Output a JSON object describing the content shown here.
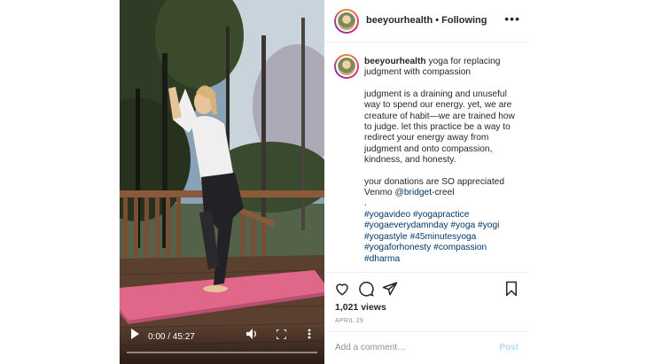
{
  "video": {
    "time": "0:00 / 45:27",
    "progress_fraction": 0.0
  },
  "header": {
    "username": "beeyourhealth",
    "separator": "•",
    "follow_status": "Following",
    "more_label": "•••"
  },
  "caption": {
    "username": "beeyourhealth",
    "title": "yoga for replacing judgment with compassion",
    "body": "judgment is a draining and unuseful way to spend our energy. yet, we are creature of habit—we are trained how to judge. let this practice be a way to redirect your energy away from judgment and onto compassion, kindness, and honesty.",
    "donation": "your donations are SO appreciated",
    "venmo_prefix": "Venmo ",
    "venmo_handle": "@bridget",
    "venmo_suffix": "-creel",
    "period": ".",
    "hashtags": [
      "#yogavideo",
      "#yogapractice",
      "#yogaeverydamnday",
      "#yoga",
      "#yogi",
      "#yogastyle",
      "#45minutesyoga",
      "#yogaforhonesty",
      "#compassion",
      "#dharma"
    ]
  },
  "stats": {
    "views": "1,021 views",
    "date": "APRIL 29"
  },
  "comment": {
    "placeholder": "Add a comment…",
    "post_label": "Post"
  },
  "icons": {
    "like": "heart-icon",
    "comment": "comment-icon",
    "share": "share-icon",
    "save": "bookmark-icon",
    "play": "play-icon",
    "volume": "volume-icon",
    "fullscreen": "fullscreen-icon",
    "options": "more-vertical-icon"
  },
  "colors": {
    "link": "#00376b",
    "post_button": "#b3dbff",
    "muted": "#8e8e8e",
    "mat": "#e0678a"
  }
}
